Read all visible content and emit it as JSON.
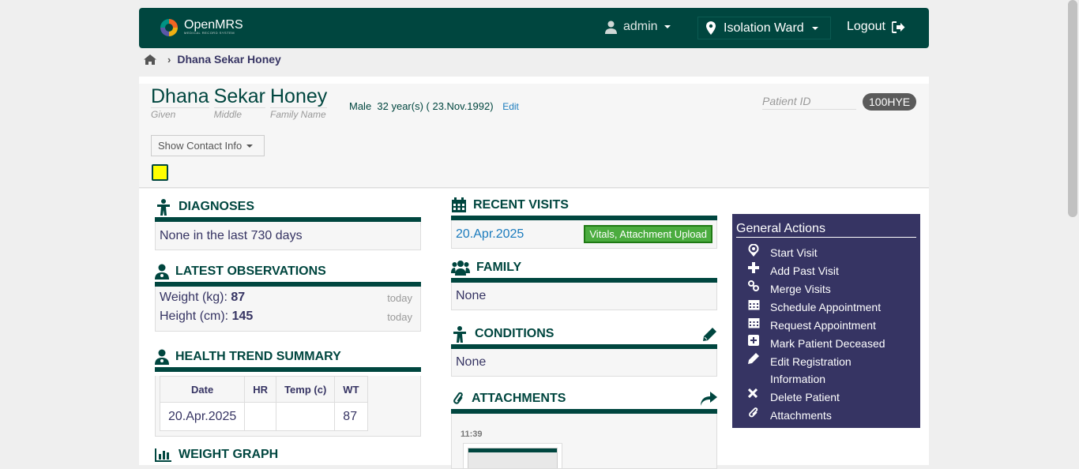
{
  "topbar": {
    "logo_text": "OpenMRS",
    "logo_subtext": "MEDICAL RECORD SYSTEM",
    "user": "admin",
    "location": "Isolation Ward",
    "logout": "Logout"
  },
  "breadcrumb": {
    "patient": "Dhana Sekar Honey"
  },
  "patient": {
    "given": "Dhana",
    "middle": "Sekar",
    "family": "Honey",
    "given_label": "Given",
    "middle_label": "Middle",
    "family_label": "Family Name",
    "demographics": "Male  32 year(s) ( 23.Nov.1992)",
    "edit": "Edit",
    "id_label": "Patient ID",
    "id_value": "100HYE",
    "contact_btn": "Show Contact Info"
  },
  "diagnoses": {
    "title": "DIAGNOSES",
    "text": "None in the last 730 days"
  },
  "observations": {
    "title": "LATEST OBSERVATIONS",
    "rows": [
      {
        "label": "Weight (kg):",
        "value": "87",
        "when": "today"
      },
      {
        "label": "Height (cm):",
        "value": "145",
        "when": "today"
      }
    ]
  },
  "trend": {
    "title": "HEALTH TREND SUMMARY",
    "headers": [
      "Date",
      "HR",
      "Temp (c)",
      "WT"
    ],
    "row": [
      "20.Apr.2025",
      "",
      "",
      "87"
    ]
  },
  "weight_graph": {
    "title": "WEIGHT GRAPH"
  },
  "recent_visits": {
    "title": "RECENT VISITS",
    "date": "20.Apr.2025",
    "tag": "Vitals, Attachment Upload"
  },
  "family": {
    "title": "FAMILY",
    "text": "None"
  },
  "conditions": {
    "title": "CONDITIONS",
    "text": "None"
  },
  "attachments": {
    "title": "ATTACHMENTS",
    "time": "11:39"
  },
  "actions": {
    "title": "General Actions",
    "items": [
      {
        "label": "Start Visit",
        "icon": "map-pin-icon"
      },
      {
        "label": "Add Past Visit",
        "icon": "plus-icon"
      },
      {
        "label": "Merge Visits",
        "icon": "link-icon"
      },
      {
        "label": "Schedule Appointment",
        "icon": "calendar-icon"
      },
      {
        "label": "Request Appointment",
        "icon": "calendar-icon"
      },
      {
        "label": "Mark Patient Deceased",
        "icon": "plus-square-icon"
      },
      {
        "label": "Edit Registration Information",
        "icon": "pencil-icon"
      },
      {
        "label": "Delete Patient",
        "icon": "close-icon"
      },
      {
        "label": "Attachments",
        "icon": "paperclip-icon"
      }
    ]
  },
  "colors": {
    "primary": "#00463f",
    "secondary": "#363463",
    "tag": "#4bac3f",
    "link": "#1a7bbd"
  }
}
